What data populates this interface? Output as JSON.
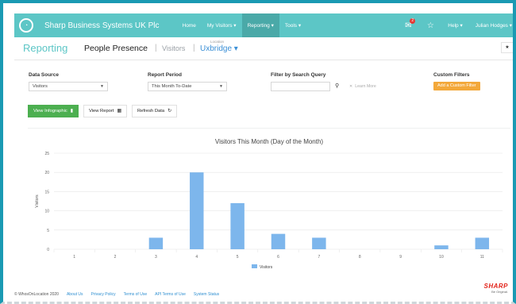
{
  "topbar": {
    "company": "Sharp Business Systems UK Plc",
    "nav": [
      "Home",
      "My Visitors ▾",
      "Reporting ▾",
      "Tools ▾"
    ],
    "active_nav": "Reporting ▾",
    "notification_count": "2",
    "help": "Help ▾",
    "user": "Julian Hodges ▾"
  },
  "subheader": {
    "reporting": "Reporting",
    "people_presence": "People Presence",
    "separator": "|",
    "visitors": "Visitors",
    "location_label": "Location",
    "location": "Uxbridge ▾",
    "star": "★"
  },
  "filters": {
    "data_source_label": "Data Source",
    "data_source_value": "Visitors",
    "report_period_label": "Report Period",
    "report_period_value": "This Month To-Date",
    "search_label": "Filter by Search Query",
    "search_placeholder": "",
    "learn_more": "Learn More",
    "custom_filters_label": "Custom Filters",
    "add_custom_filter": "Add a Custom Filter"
  },
  "buttons": {
    "view_infographic": "View Infographic",
    "view_report": "View Report",
    "refresh_data": "Refresh Data"
  },
  "chart_data": {
    "type": "bar",
    "title": "Visitors This Month (Day of the Month)",
    "ylabel": "Visitors",
    "xlabel": "",
    "categories": [
      "1",
      "2",
      "3",
      "4",
      "5",
      "6",
      "7",
      "8",
      "9",
      "10",
      "11"
    ],
    "series": [
      {
        "name": "Visitors",
        "values": [
          0,
          0,
          3,
          20,
          12,
          4,
          3,
          0,
          0,
          1,
          3
        ]
      }
    ],
    "ylim": [
      0,
      25
    ],
    "yticks": [
      0,
      5,
      10,
      15,
      20,
      25
    ],
    "legend": "bottom",
    "bar_color": "#7db6ec",
    "grid": true
  },
  "footer": {
    "copyright": "© WhosOnLocation 2020",
    "links": [
      "About Us",
      "Privacy Policy",
      "Terms of Use",
      "API Terms of Use",
      "System Status"
    ]
  },
  "brand": {
    "logo": "SHARP",
    "tagline": "Be Original."
  }
}
